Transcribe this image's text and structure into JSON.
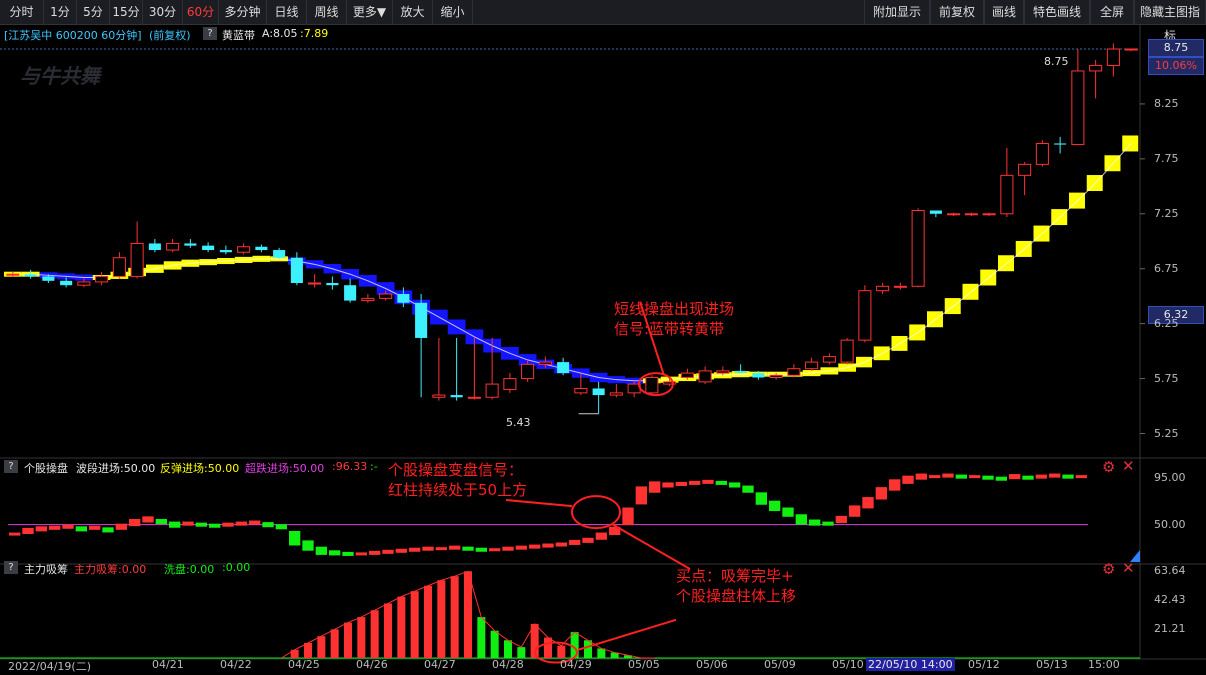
{
  "toolbar": {
    "left": [
      "分时",
      "1分",
      "5分",
      "15分",
      "30分",
      "60分",
      "多分钟",
      "日线",
      "周线",
      "更多▼",
      "放大",
      "缩小"
    ],
    "active": "60分",
    "right": [
      "附加显示",
      "前复权",
      "画线",
      "特色画线",
      "全屏",
      "隐藏主图指标"
    ]
  },
  "main_panel": {
    "stock": "[江苏吴中 600200 60分钟]",
    "adjust": "(前复权)",
    "indicator": "黄蓝带",
    "a_label": "A:8.05",
    "b_value": ":7.89",
    "watermark": "与牛共舞",
    "price_badge": "8.75",
    "pct_badge": "10.06%",
    "current_badge": "6.32",
    "y_ticks": [
      "8.25",
      "7.75",
      "7.25",
      "6.75",
      "6.25",
      "5.75",
      "5.25"
    ],
    "high_label": "8.75",
    "low_label": "5.43"
  },
  "annotations": {
    "a1_line1": "短线操盘出现进场",
    "a1_line2": "信号:蓝带转黄带",
    "a2_line1": "个股操盘变盘信号：",
    "a2_line2": "红柱持续处于50上方",
    "a3_line1": "买点：吸筹完毕+",
    "a3_line2": "个股操盘柱体上移"
  },
  "panel2": {
    "name": "个股操盘",
    "l1": "波段进场:50.00",
    "l2": "反弹进场:50.00",
    "l3": "超跌进场:50.00",
    "l4": ":96.33",
    "l5": ":-",
    "y_ticks": [
      "95.00",
      "50.00"
    ]
  },
  "panel3": {
    "name": "主力吸筹",
    "l1": "主力吸筹:0.00",
    "l2": "洗盘:0.00",
    "l3": ":0.00",
    "y_ticks": [
      "63.64",
      "42.43",
      "21.21"
    ]
  },
  "x_axis": [
    "2022/04/19(二)",
    "04/21",
    "04/22",
    "04/25",
    "04/26",
    "04/27",
    "04/28",
    "04/29",
    "05/05",
    "05/06",
    "05/09",
    "05/10",
    "22/05/10 14:00",
    "05/12",
    "05/13",
    "15:00"
  ],
  "colors": {
    "up": "#ff3232",
    "down": "#3cf0ff",
    "yellow": "#ffff00",
    "blue": "#1414ff",
    "green": "#11ee11",
    "magenta": "#e040e0",
    "annot": "#ff2020"
  },
  "chart_data": [
    {
      "type": "candlestick",
      "title": "江苏吴中 600200 60分钟",
      "ylim": [
        5.1,
        8.85
      ],
      "x": [
        "04/19",
        "04/19",
        "04/19",
        "04/19",
        "04/20",
        "04/20",
        "04/20",
        "04/20",
        "04/21",
        "04/21",
        "04/21",
        "04/21",
        "04/22",
        "04/22",
        "04/22",
        "04/22",
        "04/25",
        "04/25",
        "04/25",
        "04/25",
        "04/26",
        "04/26",
        "04/26",
        "04/26",
        "04/27",
        "04/27",
        "04/27",
        "04/27",
        "04/28",
        "04/28",
        "04/28",
        "04/28",
        "04/29",
        "04/29",
        "04/29",
        "04/29",
        "05/05",
        "05/05",
        "05/05",
        "05/05",
        "05/06",
        "05/06",
        "05/06",
        "05/06",
        "05/09",
        "05/09",
        "05/09",
        "05/09",
        "05/10",
        "05/10",
        "05/10",
        "05/10",
        "05/11",
        "05/11",
        "05/11",
        "05/11",
        "05/12",
        "05/12",
        "05/12",
        "05/12",
        "05/13",
        "05/13",
        "05/13",
        "05/13"
      ],
      "open": [
        6.7,
        6.7,
        6.68,
        6.64,
        6.6,
        6.63,
        6.68,
        6.68,
        6.98,
        6.92,
        6.98,
        6.96,
        6.92,
        6.9,
        6.95,
        6.92,
        6.85,
        6.62,
        6.62,
        6.6,
        6.46,
        6.48,
        6.52,
        6.44,
        5.58,
        5.6,
        5.58,
        5.58,
        5.65,
        5.75,
        5.88,
        5.9,
        5.62,
        5.66,
        5.6,
        5.62,
        5.62,
        5.7,
        5.76,
        5.72,
        5.8,
        5.82,
        5.8,
        5.76,
        5.78,
        5.84,
        5.9,
        5.9,
        6.1,
        6.55,
        6.59,
        6.59,
        7.28,
        7.25,
        7.25,
        7.25,
        7.25,
        7.6,
        7.7,
        7.89,
        7.88,
        8.55,
        8.6,
        8.75
      ],
      "close": [
        6.7,
        6.68,
        6.64,
        6.6,
        6.63,
        6.68,
        6.85,
        6.98,
        6.92,
        6.98,
        6.96,
        6.92,
        6.9,
        6.95,
        6.92,
        6.85,
        6.62,
        6.62,
        6.6,
        6.46,
        6.48,
        6.52,
        6.44,
        6.12,
        5.6,
        5.58,
        5.58,
        5.7,
        5.75,
        5.88,
        5.9,
        5.8,
        5.66,
        5.6,
        5.62,
        5.7,
        5.76,
        5.72,
        5.8,
        5.82,
        5.82,
        5.8,
        5.76,
        5.78,
        5.84,
        5.9,
        5.95,
        6.1,
        6.55,
        6.59,
        6.59,
        7.28,
        7.25,
        7.25,
        7.25,
        7.25,
        7.6,
        7.7,
        7.89,
        7.88,
        8.55,
        8.6,
        8.75,
        8.75
      ],
      "high": [
        6.72,
        6.74,
        6.7,
        6.67,
        6.66,
        6.72,
        6.9,
        7.18,
        7.02,
        7.02,
        7.02,
        6.99,
        6.96,
        6.98,
        6.97,
        6.94,
        6.9,
        6.7,
        6.68,
        6.66,
        6.52,
        6.55,
        6.58,
        6.52,
        6.12,
        6.12,
        6.12,
        6.12,
        5.8,
        5.92,
        5.95,
        5.94,
        5.8,
        5.72,
        5.7,
        5.72,
        5.78,
        5.76,
        5.84,
        5.86,
        5.86,
        5.88,
        5.82,
        5.8,
        5.88,
        5.94,
        5.98,
        6.12,
        6.6,
        6.62,
        6.62,
        7.3,
        7.28,
        7.26,
        7.26,
        7.26,
        7.85,
        7.72,
        7.92,
        7.95,
        8.75,
        8.65,
        8.8,
        8.75
      ],
      "low": [
        6.68,
        6.66,
        6.62,
        6.58,
        6.58,
        6.6,
        6.66,
        6.66,
        6.9,
        6.9,
        6.94,
        6.9,
        6.88,
        6.88,
        6.9,
        6.84,
        6.6,
        6.58,
        6.56,
        6.44,
        6.44,
        6.46,
        6.4,
        5.58,
        5.55,
        5.55,
        5.56,
        5.56,
        5.62,
        5.72,
        5.85,
        5.78,
        5.6,
        5.43,
        5.58,
        5.58,
        5.6,
        5.68,
        5.74,
        5.7,
        5.78,
        5.8,
        5.74,
        5.74,
        5.76,
        5.82,
        5.88,
        5.88,
        6.08,
        6.52,
        6.56,
        6.58,
        7.22,
        7.23,
        7.23,
        7.23,
        7.22,
        7.42,
        7.68,
        7.8,
        8.12,
        8.3,
        8.5,
        8.73
      ],
      "band": [
        6.7,
        6.7,
        6.69,
        6.68,
        6.67,
        6.67,
        6.69,
        6.72,
        6.75,
        6.78,
        6.8,
        6.81,
        6.82,
        6.83,
        6.84,
        6.84,
        6.82,
        6.79,
        6.75,
        6.7,
        6.64,
        6.57,
        6.49,
        6.4,
        6.31,
        6.22,
        6.13,
        6.05,
        5.98,
        5.92,
        5.88,
        5.84,
        5.8,
        5.76,
        5.74,
        5.73,
        5.73,
        5.74,
        5.76,
        5.77,
        5.78,
        5.79,
        5.79,
        5.79,
        5.79,
        5.8,
        5.82,
        5.85,
        5.9,
        5.98,
        6.07,
        6.17,
        6.29,
        6.41,
        6.54,
        6.67,
        6.8,
        6.93,
        7.07,
        7.22,
        7.37,
        7.53,
        7.71,
        7.89
      ],
      "band_colors": "blue while band falling, yellow while rising",
      "y_ticks": [
        8.75,
        8.25,
        7.75,
        7.25,
        6.75,
        6.25,
        5.75,
        5.25
      ]
    },
    {
      "type": "bar",
      "title": "个股操盘",
      "ylim": [
        20,
        110
      ],
      "reference_line": 50,
      "values": [
        41,
        44,
        46,
        47,
        48,
        46,
        47,
        45,
        48,
        52,
        55,
        53,
        50,
        51,
        50,
        49,
        50,
        51,
        52,
        50,
        48,
        37,
        30,
        25,
        23,
        22,
        22,
        23,
        24,
        25,
        26,
        27,
        27,
        28,
        27,
        26,
        26,
        27,
        28,
        29,
        30,
        31,
        33,
        35,
        39,
        44,
        58,
        78,
        86,
        88,
        89,
        90,
        91,
        90,
        88,
        84,
        75,
        68,
        62,
        55,
        52,
        51,
        55,
        63,
        71,
        80,
        88,
        93,
        96,
        96,
        97,
        96,
        96,
        95,
        94,
        96,
        95,
        96,
        97,
        96,
        96
      ]
    },
    {
      "type": "bar",
      "title": "主力吸筹",
      "ylim": [
        0,
        66
      ],
      "y_ticks": [
        63.64,
        42.43,
        21.21
      ],
      "main_values": [
        0,
        0,
        0,
        0,
        0,
        0,
        0,
        0,
        0,
        0,
        0,
        0,
        0,
        0,
        0,
        0,
        0,
        0,
        0,
        0,
        0,
        6,
        11,
        16,
        21,
        26,
        30,
        35,
        40,
        45,
        49,
        53,
        57,
        60,
        63.6,
        0,
        0,
        0,
        0,
        25,
        15,
        9,
        0,
        0,
        0,
        0,
        0,
        0,
        0,
        0,
        0,
        0,
        0,
        0,
        0,
        0,
        0,
        0,
        0,
        0,
        0,
        0,
        0,
        0,
        0,
        0,
        0,
        0,
        0,
        0,
        0,
        0,
        0,
        0,
        0,
        0,
        0,
        0,
        0,
        0,
        0
      ],
      "wash_values": [
        0,
        0,
        0,
        0,
        0,
        0,
        0,
        0,
        0,
        0,
        0,
        0,
        0,
        0,
        0,
        0,
        0,
        0,
        0,
        0,
        0,
        0,
        0,
        0,
        0,
        0,
        0,
        0,
        0,
        0,
        0,
        0,
        0,
        0,
        0,
        30,
        20,
        13,
        8,
        0,
        0,
        0,
        19,
        13,
        7,
        4,
        2,
        0,
        0,
        0,
        0,
        0,
        0,
        0,
        0,
        0,
        0,
        0,
        0,
        0,
        0,
        0,
        0,
        0,
        0,
        0,
        0,
        0,
        0,
        0,
        0,
        0,
        0,
        0,
        0,
        0,
        0,
        0,
        0,
        0,
        0
      ]
    }
  ]
}
